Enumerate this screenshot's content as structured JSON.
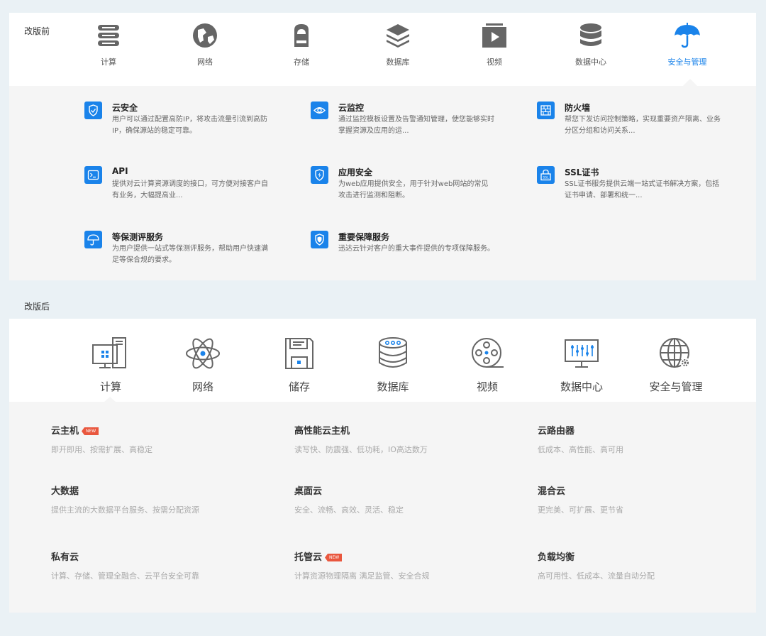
{
  "before": {
    "label": "改版前",
    "nav": [
      {
        "label": "计算",
        "icon": "server-stack-icon"
      },
      {
        "label": "网络",
        "icon": "globe-icon"
      },
      {
        "label": "存储",
        "icon": "storage-cloud-icon"
      },
      {
        "label": "数据库",
        "icon": "layers-icon"
      },
      {
        "label": "视频",
        "icon": "video-play-icon"
      },
      {
        "label": "数据中心",
        "icon": "database-icon"
      },
      {
        "label": "安全与管理",
        "icon": "umbrella-icon",
        "active": true
      }
    ],
    "active_color": "#1a83ea",
    "cards": [
      {
        "title": "云安全",
        "desc": "用户可以通过配置高防IP，将攻击流量引流到高防IP，确保源站的稳定可靠。",
        "icon": "shield-check-icon"
      },
      {
        "title": "云监控",
        "desc": "通过监控模板设置及告警通知管理，使您能够实时掌握资源及应用的运...",
        "icon": "eye-icon"
      },
      {
        "title": "防火墙",
        "desc": "帮您下发访问控制策略，实现重要资产隔离、业务分区分组和访问关系...",
        "icon": "firewall-icon"
      },
      {
        "title": "API",
        "desc": "提供对云计算资源调度的接口，可方便对接客户自有业务，大幅提高业...",
        "icon": "terminal-icon"
      },
      {
        "title": "应用安全",
        "desc": "为web应用提供安全，用于针对web网站的常见攻击进行监测和阻断。",
        "icon": "shield-bolt-icon"
      },
      {
        "title": "SSL证书",
        "desc": "SSL证书服务提供云端一站式证书解决方案，包括证书申请、部署和统一...",
        "icon": "ssl-lock-icon"
      },
      {
        "title": "等保测评服务",
        "desc": "为用户提供一站式等保测评服务，帮助用户快速满足等保合规的要求。",
        "icon": "umbrella-icon"
      },
      {
        "title": "重要保障服务",
        "desc": "迅达云针对客户的重大事件提供的专项保障服务。",
        "icon": "shield-badge-icon"
      }
    ]
  },
  "after": {
    "label": "改版后",
    "nav": [
      {
        "label": "计算",
        "icon": "computer-icon",
        "active": true
      },
      {
        "label": "网络",
        "icon": "atom-icon"
      },
      {
        "label": "储存",
        "icon": "floppy-icon"
      },
      {
        "label": "数据库",
        "icon": "database-icon"
      },
      {
        "label": "视频",
        "icon": "film-reel-icon"
      },
      {
        "label": "数据中心",
        "icon": "monitor-chart-icon"
      },
      {
        "label": "安全与管理",
        "icon": "globe-gear-icon"
      }
    ],
    "badge_text": "NEW",
    "badge_color": "#e9573e",
    "cards": [
      {
        "title": "云主机",
        "desc": "即开即用、按需扩展、高稳定",
        "new": true
      },
      {
        "title": "高性能云主机",
        "desc": "读写快、防震强、低功耗，IO高达数万"
      },
      {
        "title": "云路由器",
        "desc": "低成本、高性能、高可用"
      },
      {
        "title": "大数据",
        "desc": "提供主流的大数据平台服务、按需分配资源"
      },
      {
        "title": "桌面云",
        "desc": "安全、流畅、高效、灵活、稳定"
      },
      {
        "title": "混合云",
        "desc": "更完美、可扩展、更节省"
      },
      {
        "title": "私有云",
        "desc": "计算、存储、管理全融合、云平台安全可靠"
      },
      {
        "title": "托管云",
        "desc": "计算资源物理隔离 满足监管、安全合规",
        "new": true
      },
      {
        "title": "负载均衡",
        "desc": "高可用性、低成本、流量自动分配"
      }
    ]
  }
}
